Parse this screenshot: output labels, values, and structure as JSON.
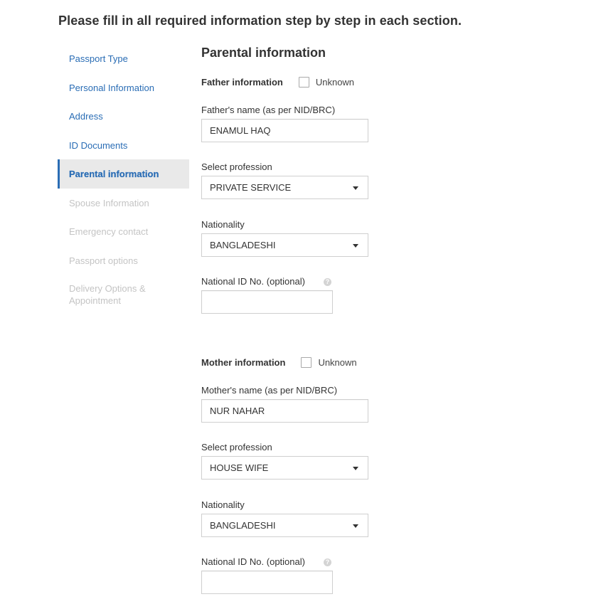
{
  "page_heading": "Please fill in all required information step by step in each section.",
  "sidebar": {
    "items": [
      {
        "label": "Passport Type",
        "state": "completed"
      },
      {
        "label": "Personal Information",
        "state": "completed"
      },
      {
        "label": "Address",
        "state": "completed"
      },
      {
        "label": "ID Documents",
        "state": "completed"
      },
      {
        "label": "Parental information",
        "state": "active"
      },
      {
        "label": "Spouse Information",
        "state": "disabled"
      },
      {
        "label": "Emergency contact",
        "state": "disabled"
      },
      {
        "label": "Passport options",
        "state": "disabled"
      },
      {
        "label": "Delivery Options & Appointment",
        "state": "disabled"
      }
    ]
  },
  "main": {
    "title": "Parental information",
    "father": {
      "heading": "Father information",
      "unknown_label": "Unknown",
      "unknown_checked": false,
      "name_label": "Father's name (as per NID/BRC)",
      "name_value": "ENAMUL HAQ",
      "profession_label": "Select profession",
      "profession_value": "PRIVATE SERVICE",
      "nationality_label": "Nationality",
      "nationality_value": "BANGLADESHI",
      "nid_label": "National ID No. (optional)",
      "nid_value": "",
      "help_glyph": "?"
    },
    "mother": {
      "heading": "Mother information",
      "unknown_label": "Unknown",
      "unknown_checked": false,
      "name_label": "Mother's name (as per NID/BRC)",
      "name_value": "NUR NAHAR",
      "profession_label": "Select profession",
      "profession_value": "HOUSE WIFE",
      "nationality_label": "Nationality",
      "nationality_value": "BANGLADESHI",
      "nid_label": "National ID No. (optional)",
      "nid_value": "",
      "help_glyph": "?"
    }
  },
  "colors": {
    "accent": "#2a6db5",
    "active_bg": "#e9e9e9",
    "disabled_text": "#c4c4c4",
    "text": "#333333",
    "border": "#cfcfcf"
  }
}
